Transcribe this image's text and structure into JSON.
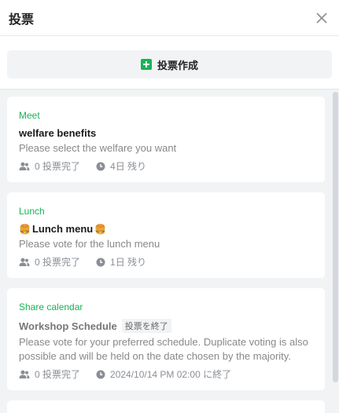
{
  "header": {
    "title": "投票",
    "close_icon": "close-icon"
  },
  "create_button": {
    "label": "投票作成",
    "icon": "plus-icon",
    "icon_color": "#16b455"
  },
  "accent_color": "#16b455",
  "polls": [
    {
      "category": "Meet",
      "title": "welfare benefits",
      "description": "Please select the welfare you want",
      "votes": "0 投票完了",
      "time": "4日 残り"
    },
    {
      "category": "Lunch",
      "title": "Lunch menu",
      "title_emoji": "🍔",
      "description": "Please vote for the lunch menu",
      "votes": "0 投票完了",
      "time": "1日 残り"
    },
    {
      "category": "Share calendar",
      "title": "Workshop Schedule",
      "badge": "投票を終了",
      "description": "Please vote for your preferred schedule. Duplicate voting is also possible and will be held on the date chosen by the majority.",
      "votes": "0 投票完了",
      "time": "2024/10/14 PM 02:00 に終了"
    }
  ]
}
